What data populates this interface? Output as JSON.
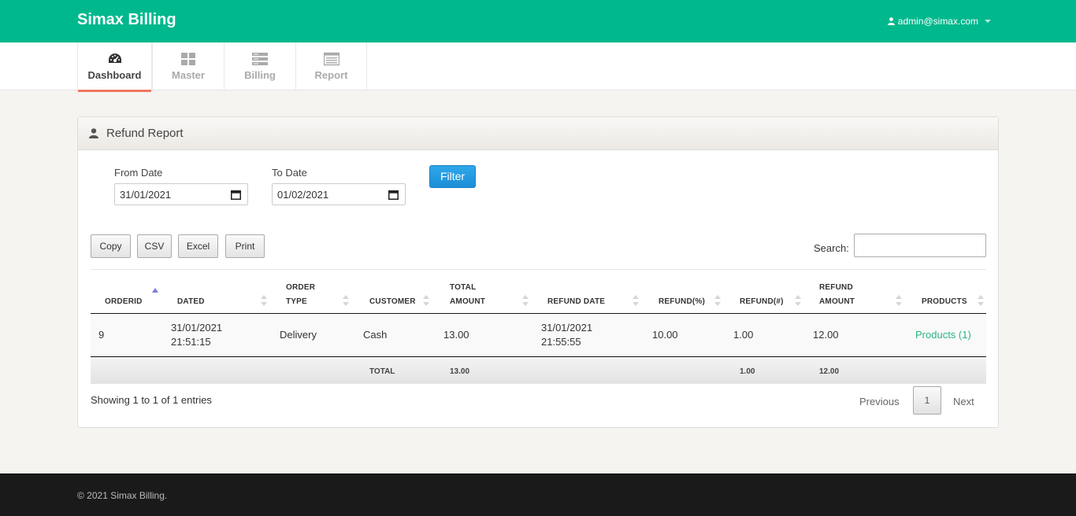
{
  "app": {
    "title": "Simax Billing",
    "user_email": "admin@simax.com"
  },
  "nav": [
    {
      "label": "Dashboard",
      "icon": "dashboard-icon",
      "active": true
    },
    {
      "label": "Master",
      "icon": "grid-icon",
      "active": false
    },
    {
      "label": "Billing",
      "icon": "list-icon",
      "active": false
    },
    {
      "label": "Report",
      "icon": "report-icon",
      "active": false
    }
  ],
  "panel": {
    "title": "Refund Report"
  },
  "filter": {
    "from_label": "From Date",
    "from_value": "31/01/2021",
    "to_label": "To Date",
    "to_value": "01/02/2021",
    "button": "Filter"
  },
  "toolbar": {
    "copy": "Copy",
    "csv": "CSV",
    "excel": "Excel",
    "print": "Print",
    "search_label": "Search:"
  },
  "table": {
    "headers": [
      [
        "ORDERID"
      ],
      [
        "DATED"
      ],
      [
        "ORDER",
        "TYPE"
      ],
      [
        "CUSTOMER"
      ],
      [
        "TOTAL",
        "AMOUNT"
      ],
      [
        "REFUND DATE"
      ],
      [
        "REFUND(%)"
      ],
      [
        "REFUND(#)"
      ],
      [
        "REFUND",
        "AMOUNT"
      ],
      [
        "PRODUCTS"
      ]
    ],
    "rows": [
      {
        "orderid": "9",
        "dated_date": "31/01/2021",
        "dated_time": "21:51:15",
        "order_type": "Delivery",
        "customer": "Cash",
        "total_amount": "13.00",
        "refund_date": "31/01/2021",
        "refund_time": "21:55:55",
        "refund_pct": "10.00",
        "refund_num": "1.00",
        "refund_amount": "12.00",
        "products": "Products (1)"
      }
    ],
    "footer": {
      "label": "TOTAL",
      "total_amount": "13.00",
      "refund_num": "1.00",
      "refund_amount": "12.00"
    }
  },
  "pagination": {
    "info": "Showing 1 to 1 of 1 entries",
    "previous": "Previous",
    "current": "1",
    "next": "Next"
  },
  "footer": {
    "copyright": "© 2021 Simax Billing."
  },
  "colors": {
    "brand": "#00b88d",
    "accent": "#f0765f",
    "link": "#2bb57f",
    "filter": "#1d8ed6"
  }
}
